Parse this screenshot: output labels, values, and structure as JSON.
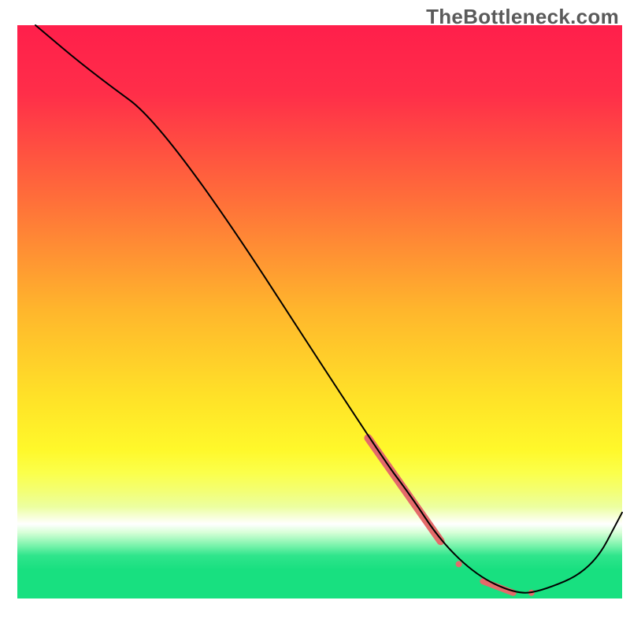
{
  "watermark": "TheBottleneck.com",
  "chart_data": {
    "type": "line",
    "title": "",
    "xlabel": "",
    "ylabel": "",
    "xlim": [
      0,
      100
    ],
    "ylim": [
      0,
      100
    ],
    "x": [
      3,
      12,
      25,
      60,
      65,
      70,
      76,
      82,
      86,
      95,
      100
    ],
    "values": [
      100,
      92,
      82,
      25,
      18,
      10,
      4,
      1,
      1,
      5,
      15
    ],
    "highlight_segments": [
      {
        "x0": 58,
        "y0": 28,
        "x1": 70,
        "y1": 10,
        "thick": 10
      },
      {
        "cx": 73,
        "cy": 6,
        "r": 4,
        "type": "dot"
      },
      {
        "x0": 77,
        "y0": 3,
        "x1": 82,
        "y1": 1,
        "thick": 8
      },
      {
        "cx": 85,
        "cy": 1,
        "r": 4,
        "type": "dot"
      }
    ],
    "gradient_stops": [
      {
        "offset": 0.0,
        "color": "#ff1f4b"
      },
      {
        "offset": 0.12,
        "color": "#ff2e49"
      },
      {
        "offset": 0.3,
        "color": "#ff6d3a"
      },
      {
        "offset": 0.5,
        "color": "#ffb72c"
      },
      {
        "offset": 0.65,
        "color": "#ffe228"
      },
      {
        "offset": 0.74,
        "color": "#fff82a"
      },
      {
        "offset": 0.78,
        "color": "#fbff4a"
      },
      {
        "offset": 0.81,
        "color": "#f4ff70"
      },
      {
        "offset": 0.84,
        "color": "#ecffa0"
      },
      {
        "offset": 0.87,
        "color": "#ffffff"
      },
      {
        "offset": 0.885,
        "color": "#d7ffd7"
      },
      {
        "offset": 0.905,
        "color": "#84f5b0"
      },
      {
        "offset": 0.925,
        "color": "#30e58c"
      },
      {
        "offset": 0.95,
        "color": "#18e080"
      },
      {
        "offset": 1.0,
        "color": "#18e080"
      }
    ],
    "highlight_color": "#e46a6a",
    "line_color": "#000000",
    "line_width": 2
  }
}
